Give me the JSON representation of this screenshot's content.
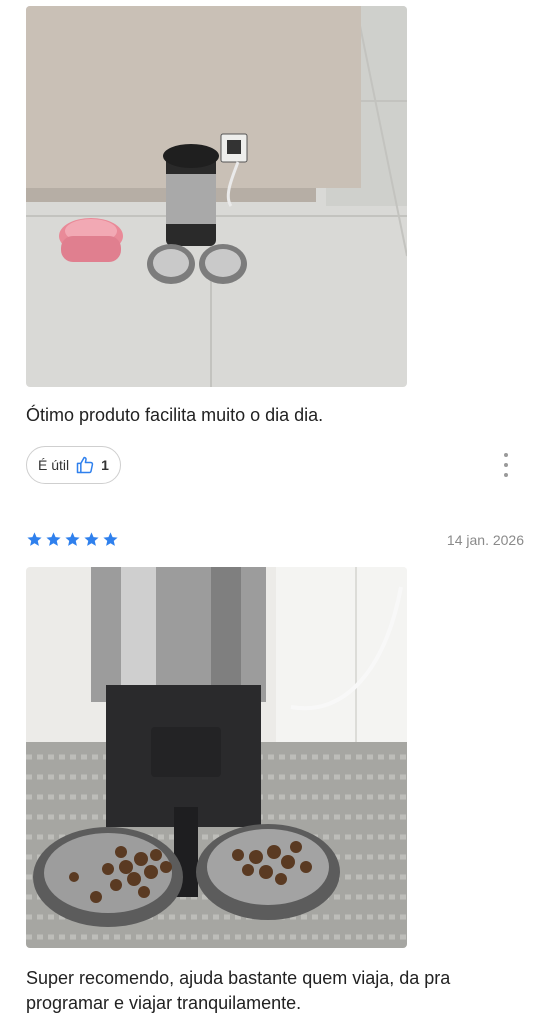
{
  "reviews": [
    {
      "text": "Ótimo produto facilita muito o dia dia.",
      "helpful_label": "É útil",
      "helpful_count": "1",
      "photo_icon": "review-photo-feeder-on-floor"
    },
    {
      "rating": 5,
      "date": "14 jan. 2026",
      "text": "Super recomendo, ajuda bastante quem viaja, da pra programar e viajar tranquilamente.",
      "photo_icon": "review-photo-feeder-with-kibble"
    }
  ],
  "colors": {
    "star": "#2f80ed",
    "thumb": "#2f80ed",
    "text": "#222222",
    "muted": "#8a8a8a"
  }
}
